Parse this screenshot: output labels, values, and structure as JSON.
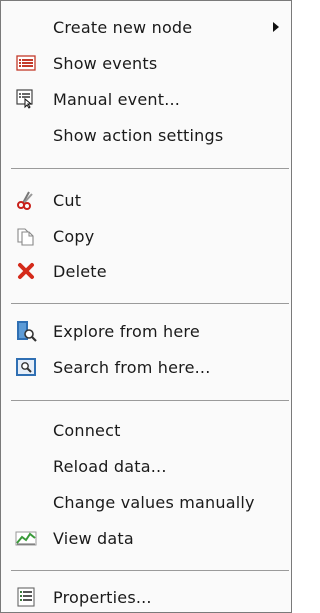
{
  "menu": {
    "items": [
      {
        "label": "Create new node",
        "icon": "none",
        "submenu": true
      },
      {
        "label": "Show events",
        "icon": "events-list-icon"
      },
      {
        "label": "Manual event...",
        "icon": "manual-event-icon"
      },
      {
        "label": "Show action settings",
        "icon": "none"
      },
      {
        "label": "Cut",
        "icon": "scissors-icon"
      },
      {
        "label": "Copy",
        "icon": "copy-icon"
      },
      {
        "label": "Delete",
        "icon": "delete-icon"
      },
      {
        "label": "Explore from here",
        "icon": "explore-icon"
      },
      {
        "label": "Search from here...",
        "icon": "search-icon"
      },
      {
        "label": "Connect",
        "icon": "none"
      },
      {
        "label": "Reload data...",
        "icon": "none"
      },
      {
        "label": "Change values manually",
        "icon": "none"
      },
      {
        "label": "View data",
        "icon": "chart-icon"
      },
      {
        "label": "Properties...",
        "icon": "properties-icon"
      }
    ],
    "colors": {
      "delete_red": "#d42a1a",
      "accent_blue": "#2f6fb3",
      "scissors_red": "#c8201a",
      "chart_green": "#3a9a3a"
    }
  }
}
